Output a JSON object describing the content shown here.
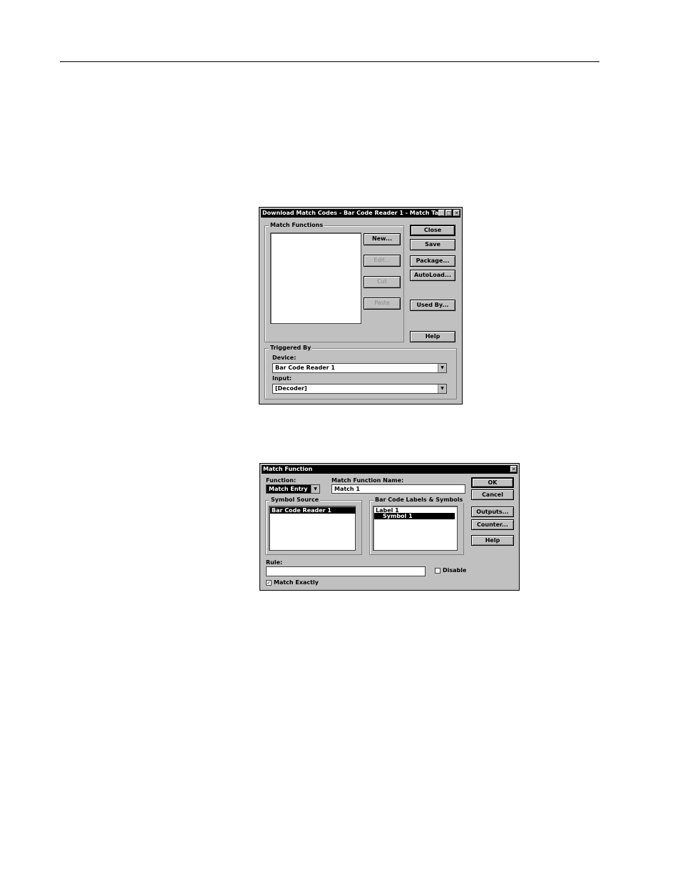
{
  "dialog1": {
    "title": "Download Match Codes - Bar Code Reader 1 - Match Ta...",
    "min_glyph": "_",
    "max_glyph": "□",
    "close_glyph": "✕",
    "match_functions_label": "Match Functions",
    "buttons": {
      "new": "New...",
      "edit": "Edit...",
      "cut": "Cut",
      "paste": "Paste",
      "close": "Close",
      "save": "Save",
      "package": "Package...",
      "autoload": "AutoLoad...",
      "used_by": "Used By...",
      "help": "Help"
    },
    "triggered_by_label": "Triggered By",
    "device_label": "Device:",
    "device_value": "Bar Code Reader 1",
    "input_label": "Input:",
    "input_value": "[Decoder]",
    "arrow_glyph": "▼"
  },
  "dialog2": {
    "title": "Match Function",
    "close_glyph": "✕",
    "function_label": "Function:",
    "function_value": "Match Entry",
    "name_label": "Match Function Name:",
    "name_value": "Match 1",
    "symbol_source_label": "Symbol Source",
    "symbol_source_items": [
      "Bar Code Reader 1"
    ],
    "labels_symbols_label": "Bar Code Labels & Symbols",
    "labels_symbols_items": [
      "Label 1",
      "Symbol 1"
    ],
    "rule_label": "Rule:",
    "rule_value": "",
    "disable_label": "Disable",
    "match_exactly_label": "Match Exactly",
    "check_glyph": "✓",
    "arrow_glyph": "▼",
    "buttons": {
      "ok": "OK",
      "cancel": "Cancel",
      "outputs": "Outputs...",
      "counter": "Counter...",
      "help": "Help"
    }
  }
}
